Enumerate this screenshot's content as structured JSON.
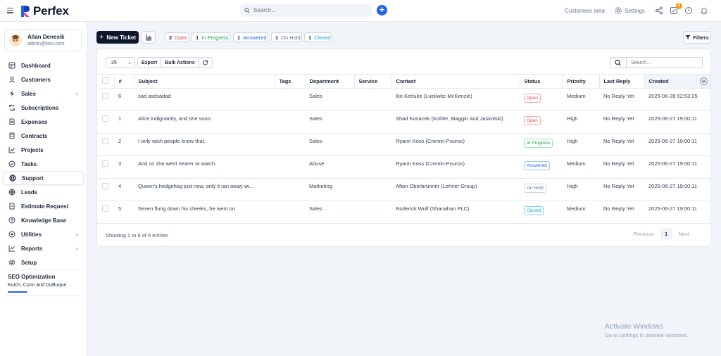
{
  "app": {
    "name": "Perfex",
    "search_placeholder": "Search...",
    "customers_area": "Customers area",
    "settings": "Settings",
    "notification_count": "3"
  },
  "profile": {
    "name": "Allan Denesik",
    "email": "admin@test.com"
  },
  "sidebar": {
    "items": [
      {
        "label": "Dashboard",
        "icon": "dashboard-icon",
        "chevron": false
      },
      {
        "label": "Customers",
        "icon": "users-icon",
        "chevron": false
      },
      {
        "label": "Sales",
        "icon": "bolt-icon",
        "chevron": true
      },
      {
        "label": "Subscriptions",
        "icon": "refresh-icon",
        "chevron": false
      },
      {
        "label": "Expenses",
        "icon": "file-icon",
        "chevron": false
      },
      {
        "label": "Contracts",
        "icon": "contract-icon",
        "chevron": false
      },
      {
        "label": "Projects",
        "icon": "chart-icon",
        "chevron": false
      },
      {
        "label": "Tasks",
        "icon": "check-circle-icon",
        "chevron": false
      },
      {
        "label": "Support",
        "icon": "lifebuoy-icon",
        "chevron": false,
        "active": true
      },
      {
        "label": "Leads",
        "icon": "target-icon",
        "chevron": false
      },
      {
        "label": "Estimate Request",
        "icon": "document-icon",
        "chevron": false
      },
      {
        "label": "Knowledge Base",
        "icon": "question-icon",
        "chevron": false
      },
      {
        "label": "Utilities",
        "icon": "cog-circle-icon",
        "chevron": true
      },
      {
        "label": "Reports",
        "icon": "line-chart-icon",
        "chevron": true
      },
      {
        "label": "Setup",
        "icon": "gear-icon",
        "chevron": false
      }
    ],
    "project": {
      "title": "SEO Optimization",
      "client": "Kutch, Conn and DuBuque"
    }
  },
  "toolbar": {
    "new_ticket": "New Ticket",
    "filters": "Filters",
    "chips": [
      {
        "count": "2",
        "label": "Open",
        "color": "#ef4444"
      },
      {
        "count": "1",
        "label": "In Progress",
        "color": "#16a34a"
      },
      {
        "count": "1",
        "label": "Answered",
        "color": "#2563eb"
      },
      {
        "count": "1",
        "label": "On Hold",
        "color": "#64748b"
      },
      {
        "count": "1",
        "label": "Closed",
        "color": "#0ea5e9"
      }
    ]
  },
  "table_controls": {
    "per_page": "25",
    "export": "Export",
    "bulk_actions": "Bulk Actions",
    "search_placeholder": "Search..."
  },
  "table": {
    "headers": [
      "#",
      "Subject",
      "Tags",
      "Department",
      "Service",
      "Contact",
      "Status",
      "Priority",
      "Last Reply",
      "Created"
    ],
    "rows": [
      {
        "id": "6",
        "subject": "sad asdsadad",
        "tags": "",
        "department": "Sales",
        "service": "",
        "contact": "Ike Kerluke (Lueilwitz-McKenzie)",
        "status": "Open",
        "status_class": "st-open",
        "priority": "Medium",
        "last_reply": "No Reply Yet",
        "created": "2025-06-28 02:53:25"
      },
      {
        "id": "1",
        "subject": "Alice indignantly, and she soon.",
        "tags": "",
        "department": "Sales",
        "service": "",
        "contact": "Shad Kovacek (Kohler, Maggio and Jaskolski)",
        "status": "Open",
        "status_class": "st-open",
        "priority": "High",
        "last_reply": "No Reply Yet",
        "created": "2025-06-27 19:00:11"
      },
      {
        "id": "2",
        "subject": "I only wish people knew that.",
        "tags": "",
        "department": "Sales",
        "service": "",
        "contact": "Ryann Koss (Cremin-Pouros)",
        "status": "In Progress",
        "status_class": "st-progress",
        "priority": "High",
        "last_reply": "No Reply Yet",
        "created": "2025-06-27 19:00:11"
      },
      {
        "id": "3",
        "subject": "And so she went nearer to watch.",
        "tags": "",
        "department": "Abuse",
        "service": "",
        "contact": "Ryann Koss (Cremin-Pouros)",
        "status": "Answered",
        "status_class": "st-answered",
        "priority": "Medium",
        "last_reply": "No Reply Yet",
        "created": "2025-06-27 19:00:11"
      },
      {
        "id": "4",
        "subject": "Queen's hedgehog just now, only it ran away wi...",
        "tags": "",
        "department": "Marketing",
        "service": "",
        "contact": "Afton Oberbrunner (Lehner Group)",
        "status": "On Hold",
        "status_class": "st-hold",
        "priority": "High",
        "last_reply": "No Reply Yet",
        "created": "2025-06-27 19:00:11"
      },
      {
        "id": "5",
        "subject": "Seven flung down his cheeks, he went on.",
        "tags": "",
        "department": "Sales",
        "service": "",
        "contact": "Roderick Wolf (Shanahan PLC)",
        "status": "Closed",
        "status_class": "st-closed",
        "priority": "Medium",
        "last_reply": "No Reply Yet",
        "created": "2025-06-27 19:00:11"
      }
    ]
  },
  "pagination": {
    "showing": "Showing 1 to 6 of 6 entries",
    "previous": "Previous",
    "page": "1",
    "next": "Next"
  },
  "watermark": {
    "title": "Activate Windows",
    "subtitle": "Go to Settings to activate Windows."
  }
}
